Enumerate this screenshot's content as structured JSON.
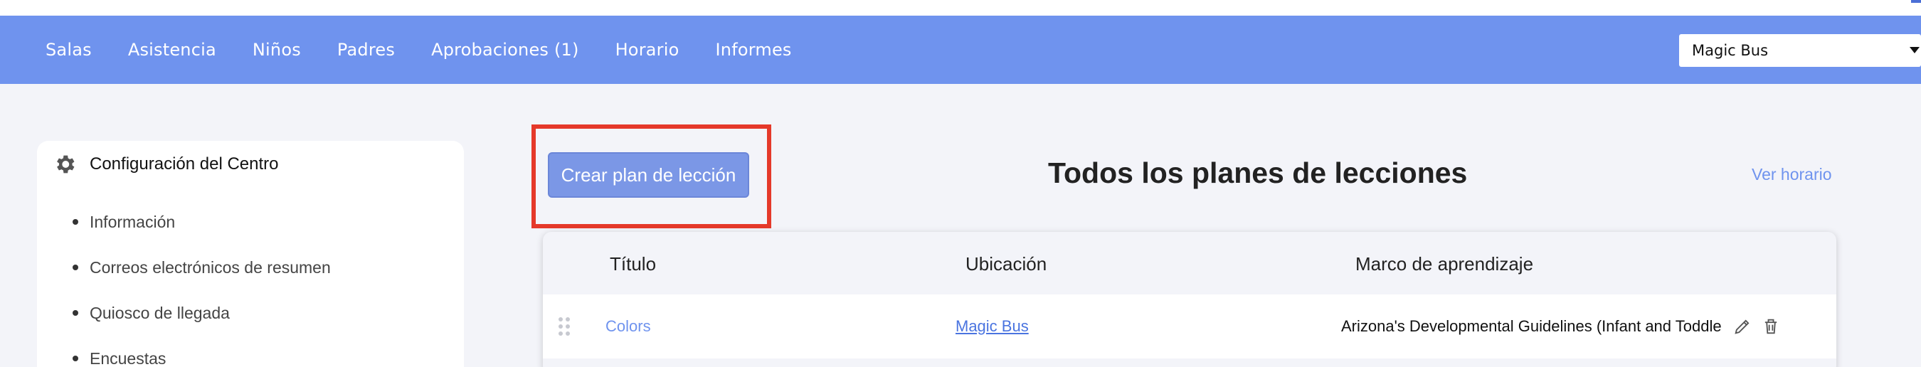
{
  "nav": {
    "links": [
      "Salas",
      "Asistencia",
      "Niños",
      "Padres",
      "Aprobaciones (1)",
      "Horario",
      "Informes"
    ],
    "center_select": {
      "value": "Magic Bus"
    },
    "bar_color": "#6f93ee"
  },
  "sidebar": {
    "title": "Configuración del Centro",
    "title_icon": "gear-icon",
    "items": [
      "Información",
      "Correos electrónicos de resumen",
      "Quiosco de llegada",
      "Encuestas"
    ]
  },
  "main": {
    "create_button": "Crear plan de lección",
    "title": "Todos los planes de lecciones",
    "view_schedule": "Ver horario",
    "highlight_color": "#e5392a"
  },
  "table": {
    "headers": [
      "Título",
      "Ubicación",
      "Marco de aprendizaje"
    ],
    "rows": [
      {
        "title": "Colors",
        "location": "Magic Bus",
        "framework": "Arizona's Developmental Guidelines (Infant and Toddle",
        "actions": [
          "pencil-icon",
          "trash-icon"
        ]
      }
    ]
  }
}
